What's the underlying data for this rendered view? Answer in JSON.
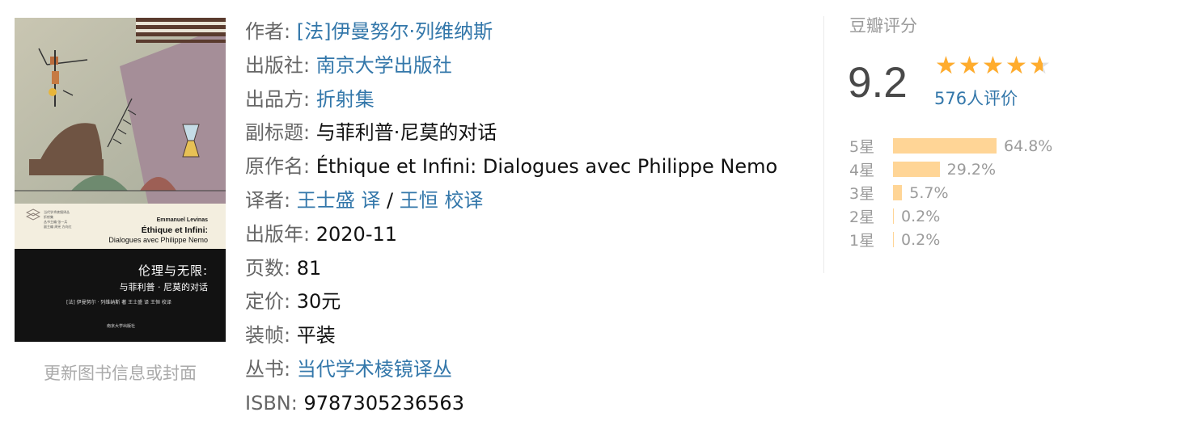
{
  "cover": {
    "author_en": "Emmanuel Levinas",
    "title_en": "Éthique et Infini:",
    "subtitle_en": "Dialogues avec Philippe Nemo",
    "title_cn": "伦理与无限:",
    "subtitle_cn": "与菲利普 · 尼莫的对话",
    "credits": "[法] 伊曼努尔 · 列维纳斯 著    王士盛 译    王恒 校译",
    "publisher": "南京大学出版社",
    "series_lines": [
      "当代学术棱镜译丛",
      "折射集",
      "丛书主编 张一兵",
      "副主编 周宪 方向红"
    ]
  },
  "update_link": "更新图书信息或封面",
  "info": {
    "author": {
      "label": "作者:",
      "value": "[法]伊曼努尔·列维纳斯"
    },
    "publisher": {
      "label": "出版社:",
      "value": "南京大学出版社"
    },
    "producer": {
      "label": "出品方:",
      "value": "折射集"
    },
    "subtitle": {
      "label": "副标题:",
      "value": "与菲利普·尼莫的对话"
    },
    "original_title": {
      "label": "原作名:",
      "value": "Éthique et Infini: Dialogues avec Philippe Nemo"
    },
    "translator": {
      "label": "译者:",
      "value1": "王士盛 译",
      "sep": "/",
      "value2": "王恒 校译"
    },
    "pub_year": {
      "label": "出版年:",
      "value": "2020-11"
    },
    "pages": {
      "label": "页数:",
      "value": "81"
    },
    "price": {
      "label": "定价:",
      "value": "30元"
    },
    "binding": {
      "label": "装帧:",
      "value": "平装"
    },
    "series": {
      "label": "丛书:",
      "value": "当代学术棱镜译丛"
    },
    "isbn": {
      "label": "ISBN:",
      "value": "9787305236563"
    }
  },
  "rating": {
    "title": "豆瓣评分",
    "score": "9.2",
    "stars_value": 4.6,
    "stars_max": 5,
    "votes": "576人评价",
    "distribution": [
      {
        "label": "5星",
        "percent": 64.8,
        "text": "64.8%"
      },
      {
        "label": "4星",
        "percent": 29.2,
        "text": "29.2%"
      },
      {
        "label": "3星",
        "percent": 5.7,
        "text": "5.7%"
      },
      {
        "label": "2星",
        "percent": 0.2,
        "text": "0.2%"
      },
      {
        "label": "1星",
        "percent": 0.2,
        "text": "0.2%"
      }
    ]
  },
  "colors": {
    "link": "#3377aa",
    "star": "#ffac2d",
    "bar": "#ffd596",
    "muted": "#9b9b9b"
  }
}
